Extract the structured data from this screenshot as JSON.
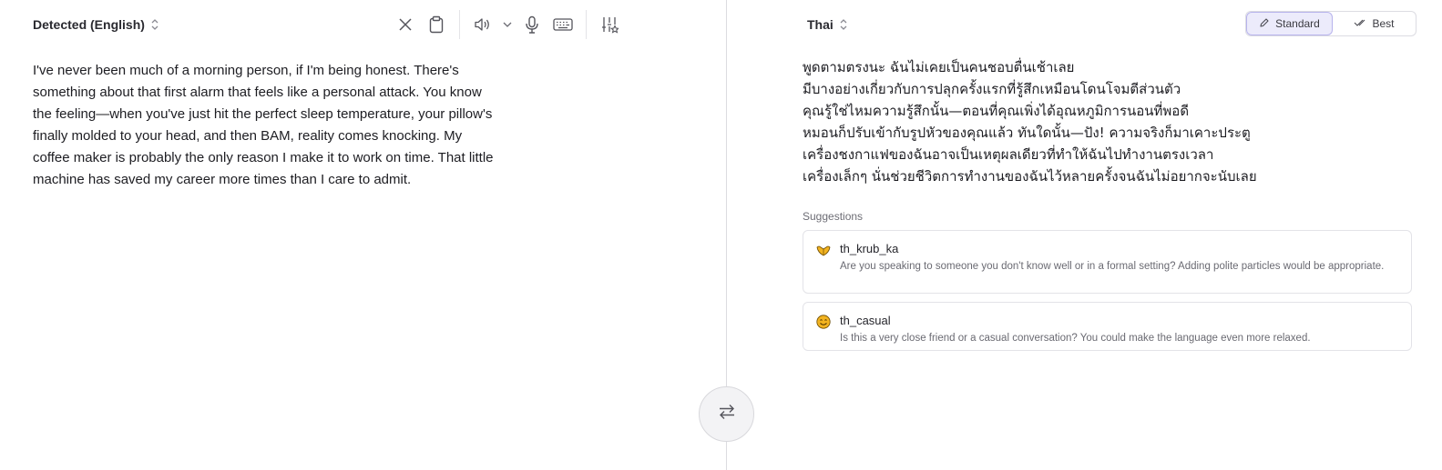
{
  "source": {
    "language_label": "Detected (English)",
    "text": "I've never been much of a morning person, if I'm being honest. There's something about that first alarm that feels like a personal attack. You know the feeling—when you've just hit the perfect sleep temperature, your pillow's finally molded to your head, and then BAM, reality comes knocking. My coffee maker is probably the only reason I make it to work on time. That little machine has saved my career more times than I care to admit."
  },
  "toolbar": {
    "icons": [
      "close-icon",
      "clipboard-icon",
      "speaker-icon",
      "chevron-down-icon",
      "microphone-icon",
      "keyboard-icon",
      "settings-sliders-icon"
    ]
  },
  "target": {
    "language_label": "Thai",
    "modes": {
      "standard": "Standard",
      "best": "Best",
      "selected": "Standard"
    },
    "translation": "พูดตามตรงนะ ฉันไม่เคยเป็นคนชอบตื่นเช้าเลย\nมีบางอย่างเกี่ยวกับการปลุกครั้งแรกที่รู้สึกเหมือนโดนโจมตีส่วนตัว\nคุณรู้ใช่ไหมความรู้สึกนั้น—ตอนที่คุณเพิ่งได้อุณหภูมิการนอนที่พอดี\nหมอนก็ปรับเข้ากับรูปหัวของคุณแล้ว ทันใดนั้น—ปัง! ความจริงก็มาเคาะประตู\nเครื่องชงกาแฟของฉันอาจเป็นเหตุผลเดียวที่ทำให้ฉันไปทำงานตรงเวลา\nเครื่องเล็กๆ นั่นช่วยชีวิตการทำงานของฉันไว้หลายครั้งจนฉันไม่อยากจะนับเลย"
  },
  "suggestions": {
    "heading": "Suggestions",
    "items": [
      {
        "title": "th_krub_ka",
        "description": "Are you speaking to someone you don't know well or in a formal setting? Adding polite particles would be appropriate.",
        "icon": "wai-hands-emoji-icon"
      },
      {
        "title": "th_casual",
        "description": "Is this a very close friend or a casual conversation? You could make the language even more relaxed.",
        "icon": "smiley-emoji-icon"
      }
    ]
  },
  "colors": {
    "accent": "#ecebfb",
    "accent_border": "#b7b3ec",
    "divider": "#dcdce0",
    "emoji": "#f2b320"
  }
}
